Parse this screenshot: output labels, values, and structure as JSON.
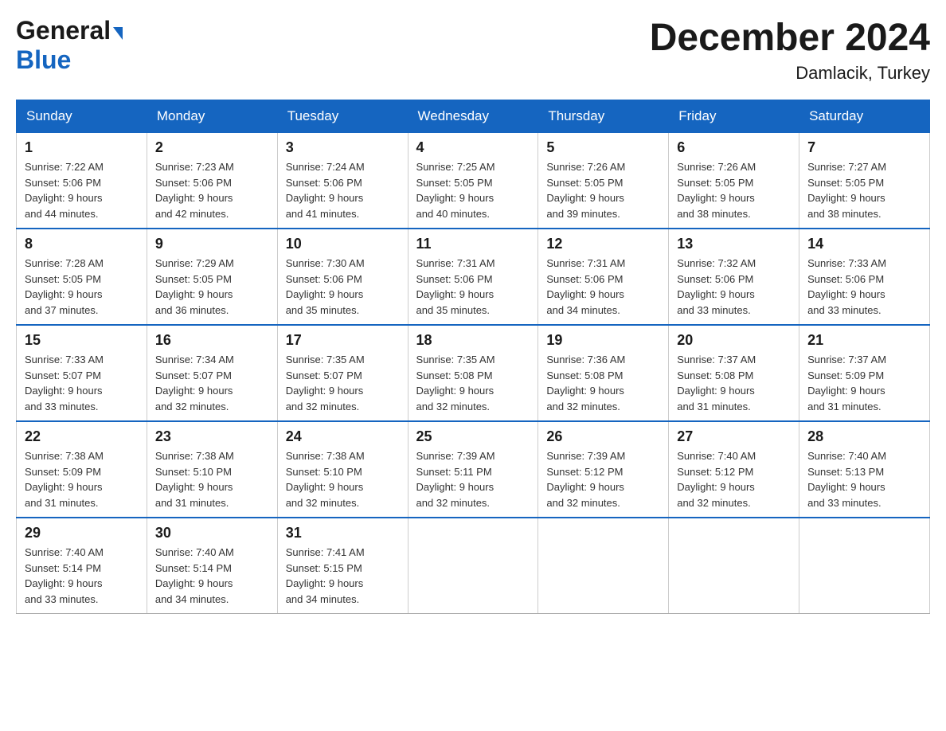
{
  "header": {
    "logo_general": "General",
    "logo_blue": "Blue",
    "month_title": "December 2024",
    "location": "Damlacik, Turkey"
  },
  "days_of_week": [
    "Sunday",
    "Monday",
    "Tuesday",
    "Wednesday",
    "Thursday",
    "Friday",
    "Saturday"
  ],
  "weeks": [
    [
      {
        "day": "1",
        "sunrise": "7:22 AM",
        "sunset": "5:06 PM",
        "daylight": "9 hours and 44 minutes."
      },
      {
        "day": "2",
        "sunrise": "7:23 AM",
        "sunset": "5:06 PM",
        "daylight": "9 hours and 42 minutes."
      },
      {
        "day": "3",
        "sunrise": "7:24 AM",
        "sunset": "5:06 PM",
        "daylight": "9 hours and 41 minutes."
      },
      {
        "day": "4",
        "sunrise": "7:25 AM",
        "sunset": "5:05 PM",
        "daylight": "9 hours and 40 minutes."
      },
      {
        "day": "5",
        "sunrise": "7:26 AM",
        "sunset": "5:05 PM",
        "daylight": "9 hours and 39 minutes."
      },
      {
        "day": "6",
        "sunrise": "7:26 AM",
        "sunset": "5:05 PM",
        "daylight": "9 hours and 38 minutes."
      },
      {
        "day": "7",
        "sunrise": "7:27 AM",
        "sunset": "5:05 PM",
        "daylight": "9 hours and 38 minutes."
      }
    ],
    [
      {
        "day": "8",
        "sunrise": "7:28 AM",
        "sunset": "5:05 PM",
        "daylight": "9 hours and 37 minutes."
      },
      {
        "day": "9",
        "sunrise": "7:29 AM",
        "sunset": "5:05 PM",
        "daylight": "9 hours and 36 minutes."
      },
      {
        "day": "10",
        "sunrise": "7:30 AM",
        "sunset": "5:06 PM",
        "daylight": "9 hours and 35 minutes."
      },
      {
        "day": "11",
        "sunrise": "7:31 AM",
        "sunset": "5:06 PM",
        "daylight": "9 hours and 35 minutes."
      },
      {
        "day": "12",
        "sunrise": "7:31 AM",
        "sunset": "5:06 PM",
        "daylight": "9 hours and 34 minutes."
      },
      {
        "day": "13",
        "sunrise": "7:32 AM",
        "sunset": "5:06 PM",
        "daylight": "9 hours and 33 minutes."
      },
      {
        "day": "14",
        "sunrise": "7:33 AM",
        "sunset": "5:06 PM",
        "daylight": "9 hours and 33 minutes."
      }
    ],
    [
      {
        "day": "15",
        "sunrise": "7:33 AM",
        "sunset": "5:07 PM",
        "daylight": "9 hours and 33 minutes."
      },
      {
        "day": "16",
        "sunrise": "7:34 AM",
        "sunset": "5:07 PM",
        "daylight": "9 hours and 32 minutes."
      },
      {
        "day": "17",
        "sunrise": "7:35 AM",
        "sunset": "5:07 PM",
        "daylight": "9 hours and 32 minutes."
      },
      {
        "day": "18",
        "sunrise": "7:35 AM",
        "sunset": "5:08 PM",
        "daylight": "9 hours and 32 minutes."
      },
      {
        "day": "19",
        "sunrise": "7:36 AM",
        "sunset": "5:08 PM",
        "daylight": "9 hours and 32 minutes."
      },
      {
        "day": "20",
        "sunrise": "7:37 AM",
        "sunset": "5:08 PM",
        "daylight": "9 hours and 31 minutes."
      },
      {
        "day": "21",
        "sunrise": "7:37 AM",
        "sunset": "5:09 PM",
        "daylight": "9 hours and 31 minutes."
      }
    ],
    [
      {
        "day": "22",
        "sunrise": "7:38 AM",
        "sunset": "5:09 PM",
        "daylight": "9 hours and 31 minutes."
      },
      {
        "day": "23",
        "sunrise": "7:38 AM",
        "sunset": "5:10 PM",
        "daylight": "9 hours and 31 minutes."
      },
      {
        "day": "24",
        "sunrise": "7:38 AM",
        "sunset": "5:10 PM",
        "daylight": "9 hours and 32 minutes."
      },
      {
        "day": "25",
        "sunrise": "7:39 AM",
        "sunset": "5:11 PM",
        "daylight": "9 hours and 32 minutes."
      },
      {
        "day": "26",
        "sunrise": "7:39 AM",
        "sunset": "5:12 PM",
        "daylight": "9 hours and 32 minutes."
      },
      {
        "day": "27",
        "sunrise": "7:40 AM",
        "sunset": "5:12 PM",
        "daylight": "9 hours and 32 minutes."
      },
      {
        "day": "28",
        "sunrise": "7:40 AM",
        "sunset": "5:13 PM",
        "daylight": "9 hours and 33 minutes."
      }
    ],
    [
      {
        "day": "29",
        "sunrise": "7:40 AM",
        "sunset": "5:14 PM",
        "daylight": "9 hours and 33 minutes."
      },
      {
        "day": "30",
        "sunrise": "7:40 AM",
        "sunset": "5:14 PM",
        "daylight": "9 hours and 34 minutes."
      },
      {
        "day": "31",
        "sunrise": "7:41 AM",
        "sunset": "5:15 PM",
        "daylight": "9 hours and 34 minutes."
      },
      null,
      null,
      null,
      null
    ]
  ],
  "labels": {
    "sunrise": "Sunrise:",
    "sunset": "Sunset:",
    "daylight": "Daylight:"
  }
}
